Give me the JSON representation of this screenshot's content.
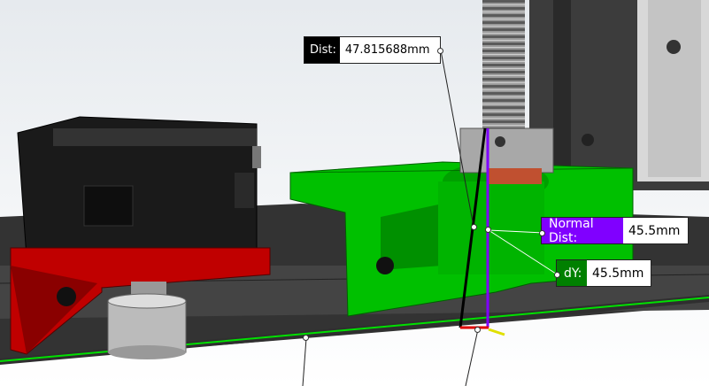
{
  "measurements": {
    "dist": {
      "label": "Dist:",
      "value": "47.815688mm",
      "color": "#000000"
    },
    "normal_dist": {
      "label": "Normal Dist:",
      "value": "45.5mm",
      "color": "#8000ff"
    },
    "dy": {
      "label": "dY:",
      "value": "45.5mm",
      "color": "#008000"
    }
  },
  "colors": {
    "part_green": "#00c000",
    "part_red": "#c00000",
    "frame_dark": "#3a3a3a",
    "motor_black": "#1a1a1a"
  }
}
